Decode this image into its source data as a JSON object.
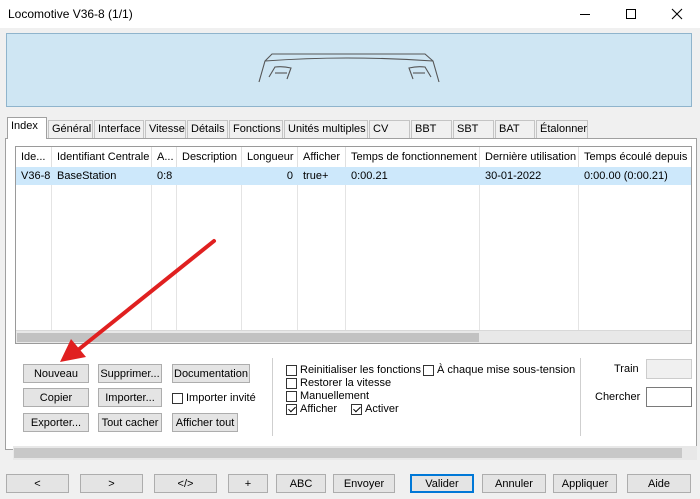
{
  "window": {
    "title": "Locomotive V36-8 (1/1)",
    "controls": [
      "minimize-icon",
      "maximize-icon",
      "close-icon"
    ]
  },
  "tabs": [
    {
      "label": "Index",
      "active": true
    },
    {
      "label": "Général"
    },
    {
      "label": "Interface"
    },
    {
      "label": "Vitesse"
    },
    {
      "label": "Détails"
    },
    {
      "label": "Fonctions"
    },
    {
      "label": "Unités multiples"
    },
    {
      "label": "CV"
    },
    {
      "label": "BBT"
    },
    {
      "label": "SBT"
    },
    {
      "label": "BAT"
    },
    {
      "label": "Étalonner"
    }
  ],
  "table": {
    "columns": [
      "Ide...",
      "Identifiant Centrale",
      "A...",
      "Description",
      "Longueur",
      "Afficher",
      "Temps de fonctionnement",
      "Dernière utilisation",
      "Temps écoulé depuis ré"
    ],
    "rows": [
      [
        "V36-8",
        "BaseStation",
        "0:8",
        "",
        "0",
        "true+",
        "0:00.21",
        "30-01-2022",
        "0:00.00 (0:00.21)"
      ]
    ]
  },
  "actions": {
    "nouveau": "Nouveau",
    "supprimer": "Supprimer...",
    "documentation": "Documentation",
    "copier": "Copier",
    "importer": "Importer...",
    "exporter": "Exporter...",
    "tout_cacher": "Tout cacher",
    "afficher_tout": "Afficher tout"
  },
  "options": {
    "importer_invite": {
      "label": "Importer invité",
      "checked": false
    },
    "reinitialiser": {
      "label": "Reinitialiser les fonctions",
      "checked": false
    },
    "chaque_mise": {
      "label": "À chaque mise sous-tension",
      "checked": false
    },
    "restorer": {
      "label": "Restorer la vitesse",
      "checked": false
    },
    "manuellement": {
      "label": "Manuellement",
      "checked": false
    },
    "afficher": {
      "label": "Afficher",
      "checked": true
    },
    "activer": {
      "label": "Activer",
      "checked": true
    }
  },
  "fields": {
    "train_label": "Train",
    "chercher_label": "Chercher",
    "chercher_value": ""
  },
  "bottom": {
    "prev": "<",
    "next": ">",
    "code": "</>",
    "plus": "+",
    "abc": "ABC",
    "envoyer": "Envoyer",
    "valider": "Valider",
    "annuler": "Annuler",
    "appliquer": "Appliquer",
    "aide": "Aide"
  },
  "colors": {
    "preview_bg": "#cfe6f3",
    "selected_row": "#cde8fb",
    "default_button_border": "#0078d7",
    "arrow": "#e02020"
  }
}
